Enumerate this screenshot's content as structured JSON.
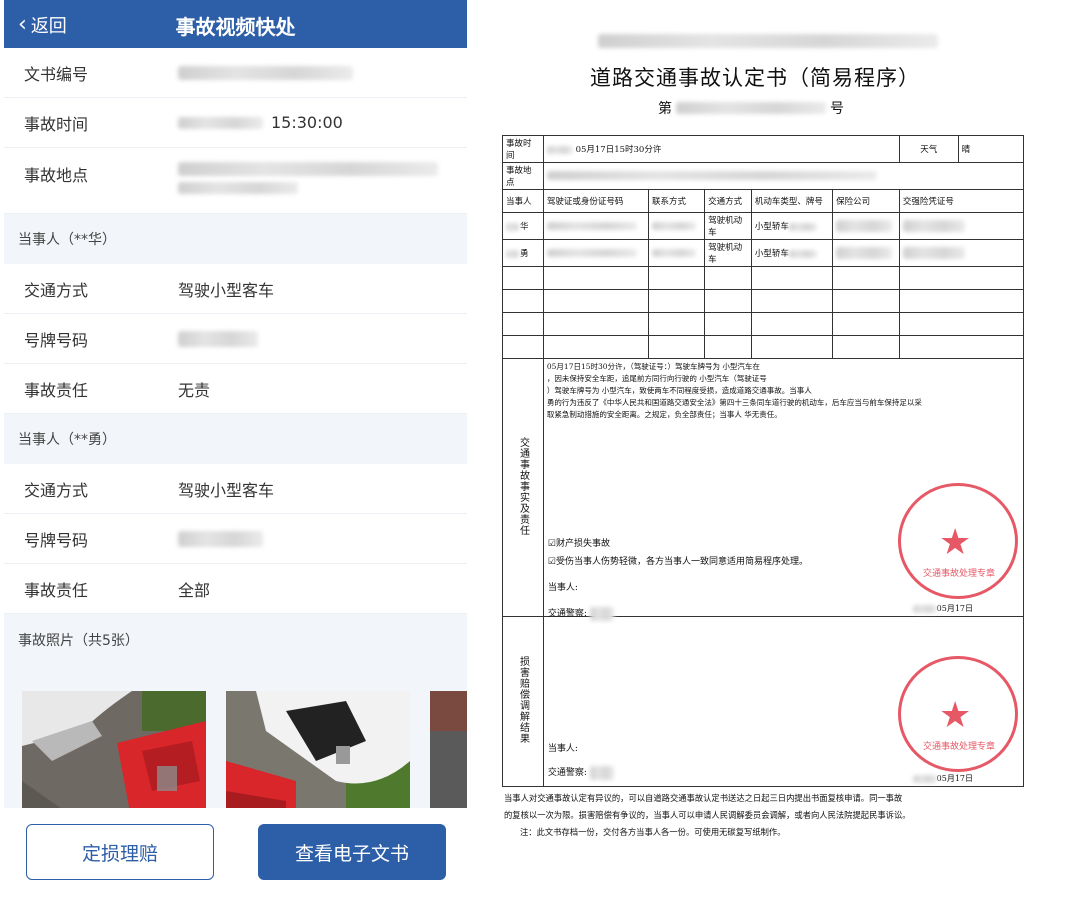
{
  "app": {
    "back_label": "返回",
    "title": "事故视频快处"
  },
  "info": {
    "doc_no_label": "文书编号",
    "time_label": "事故时间",
    "time_value": "15:30:00",
    "place_label": "事故地点"
  },
  "party1": {
    "header": "当事人（**华）",
    "mode_label": "交通方式",
    "mode_value": "驾驶小型客车",
    "plate_label": "号牌号码",
    "resp_label": "事故责任",
    "resp_value": "无责"
  },
  "party2": {
    "header": "当事人（**勇）",
    "mode_label": "交通方式",
    "mode_value": "驾驶小型客车",
    "plate_label": "号牌号码",
    "resp_label": "事故责任",
    "resp_value": "全部"
  },
  "photos": {
    "header": "事故照片（共5张）"
  },
  "buttons": {
    "assess_label": "定损理赔",
    "view_doc_label": "查看电子文书"
  },
  "colors": {
    "brand_blue": "#2d5ea8",
    "no_fault_green": "#27b04d",
    "full_fault_red": "#e2231a",
    "seal_red": "#e23c4b"
  },
  "document": {
    "title": "道路交通事故认定书（简易程序）",
    "number_prefix": "第",
    "number_suffix": "号",
    "time_label": "事故时间",
    "time_value": "05月17日15时30分许",
    "weather_label": "天气",
    "weather_value": "晴",
    "place_label": "事故地点",
    "headers": [
      "当事人",
      "驾驶证或身份证号码",
      "联系方式",
      "交通方式",
      "机动车类型、牌号",
      "保险公司",
      "交强险凭证号"
    ],
    "party1_name_suffix": "华",
    "party2_name_suffix": "勇",
    "mode_value": "驾驶机动车",
    "vehicle_prefix": "小型轿车",
    "facts_side_label": "交通事故事实及责任",
    "facts_line1": "05月17日15时30分许，（驾驶证号：）驾驶车牌号为 小型汽车在",
    "facts_line2": "，因未保持安全车距，追尾前方同行向行驶的 小型汽车（驾驶证号",
    "facts_line3": "）驾驶车牌号为 小型汽车，致使两车不同程度受损，造成道路交通事故。当事人",
    "facts_line4": "勇的行为违反了《中华人民共和国道路交通安全法》第四十三条同车道行驶的机动车，后车应当与前车保持足以采",
    "facts_line5": "取紧急制动措施的安全距离。之规定，负全部责任；当事人 华无责任。",
    "check1": "☑财产损失事故",
    "check2": "☑受伤当事人伤势轻微，各方当事人一致同意适用简易程序处理。",
    "party_sign": "当事人:",
    "officer_sign": "交通警察:",
    "sign_date": "05月17日",
    "mediation_side_label": "损害赔偿调解结果",
    "note1": "当事人对交通事故认定有异议的，可以自道路交通事故认定书送达之日起三日内提出书面复核申请。同一事故",
    "note2": "的复核以一次为限。损害赔偿有争议的，当事人可以申请人民调解委员会调解，或者向人民法院提起民事诉讼。",
    "note3": "注：此文书存档一份，交付各方当事人各一份。可使用无碳复写纸制作。",
    "seal_text": "交通事故处理专章"
  }
}
